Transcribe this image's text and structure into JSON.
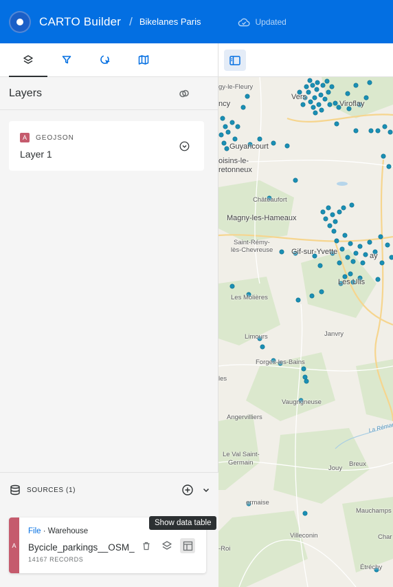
{
  "header": {
    "app_title": "CARTO Builder",
    "separator": "/",
    "map_name": "Bikelanes Paris",
    "status": "Updated",
    "brand_color": "#036fe2"
  },
  "sidebar": {
    "tabs": [
      {
        "icon": "layers-icon",
        "active": true
      },
      {
        "icon": "filter-icon",
        "active": false
      },
      {
        "icon": "interactions-icon",
        "active": false
      },
      {
        "icon": "basemap-icon",
        "active": false
      }
    ],
    "layers_title": "Layers",
    "layer": {
      "badge": "A",
      "type_label": "GEOJSON",
      "name": "Layer 1"
    },
    "sources": {
      "label": "SOURCES (1)",
      "item": {
        "badge": "A",
        "kind": "File",
        "dot": " · ",
        "location": "Warehouse",
        "name": "Bycicle_parkings__OSM_",
        "records": "14167 RECORDS"
      },
      "tooltip": "Show data table"
    }
  },
  "map": {
    "towns": [
      "gy-le-Fleury",
      "Vers",
      "Viroflay",
      "ncy",
      "Guyancourt",
      "oisins-le-",
      "retonneux",
      "Châteaufort",
      "Magny-les-Hameaux",
      "Saint-Rémy-",
      "lès-Chevreuse",
      "Gif-sur-Yvette",
      "ay",
      "Les Ulis",
      "Les Molières",
      "Limours",
      "Janvry",
      "Forges-les-Bains",
      "les",
      "Vaugrigneuse",
      "Angervilliers",
      "Le Val Saint-",
      "Germain",
      "Jouy",
      "Breux",
      "Mauchamps",
      "ermaise",
      "Villeconin",
      "Char",
      "-Roi",
      "Étréchy",
      "La Rémarde"
    ],
    "point_color": "#1a8fb4"
  }
}
